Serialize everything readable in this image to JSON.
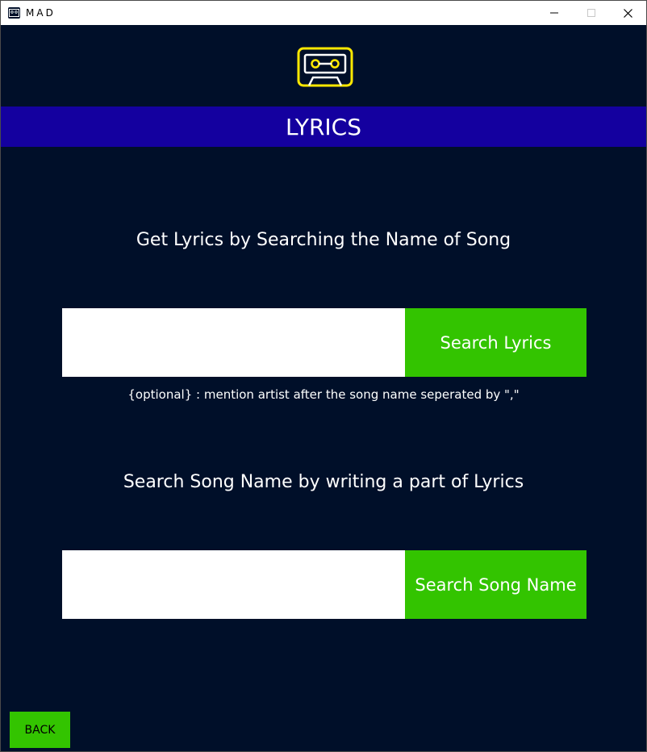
{
  "window": {
    "title": "MAD",
    "icons": [
      "app-cassette-icon",
      "minimize-icon",
      "maximize-icon",
      "close-icon"
    ]
  },
  "header": {
    "logo_icon": "cassette-icon",
    "banner_title": "LYRICS"
  },
  "search_lyrics": {
    "heading": "Get Lyrics by Searching the Name of Song",
    "input_value": "",
    "button_label": "Search Lyrics",
    "hint": "{optional} : mention artist after the song name seperated by \",\""
  },
  "search_song": {
    "heading": "Search Song Name by writing a part of Lyrics",
    "input_value": "",
    "button_label": "Search Song Name"
  },
  "footer": {
    "back_label": "BACK"
  },
  "colors": {
    "background": "#000f29",
    "banner": "#14009f",
    "button_green": "#33c400",
    "logo_yellow": "#ffe800"
  }
}
